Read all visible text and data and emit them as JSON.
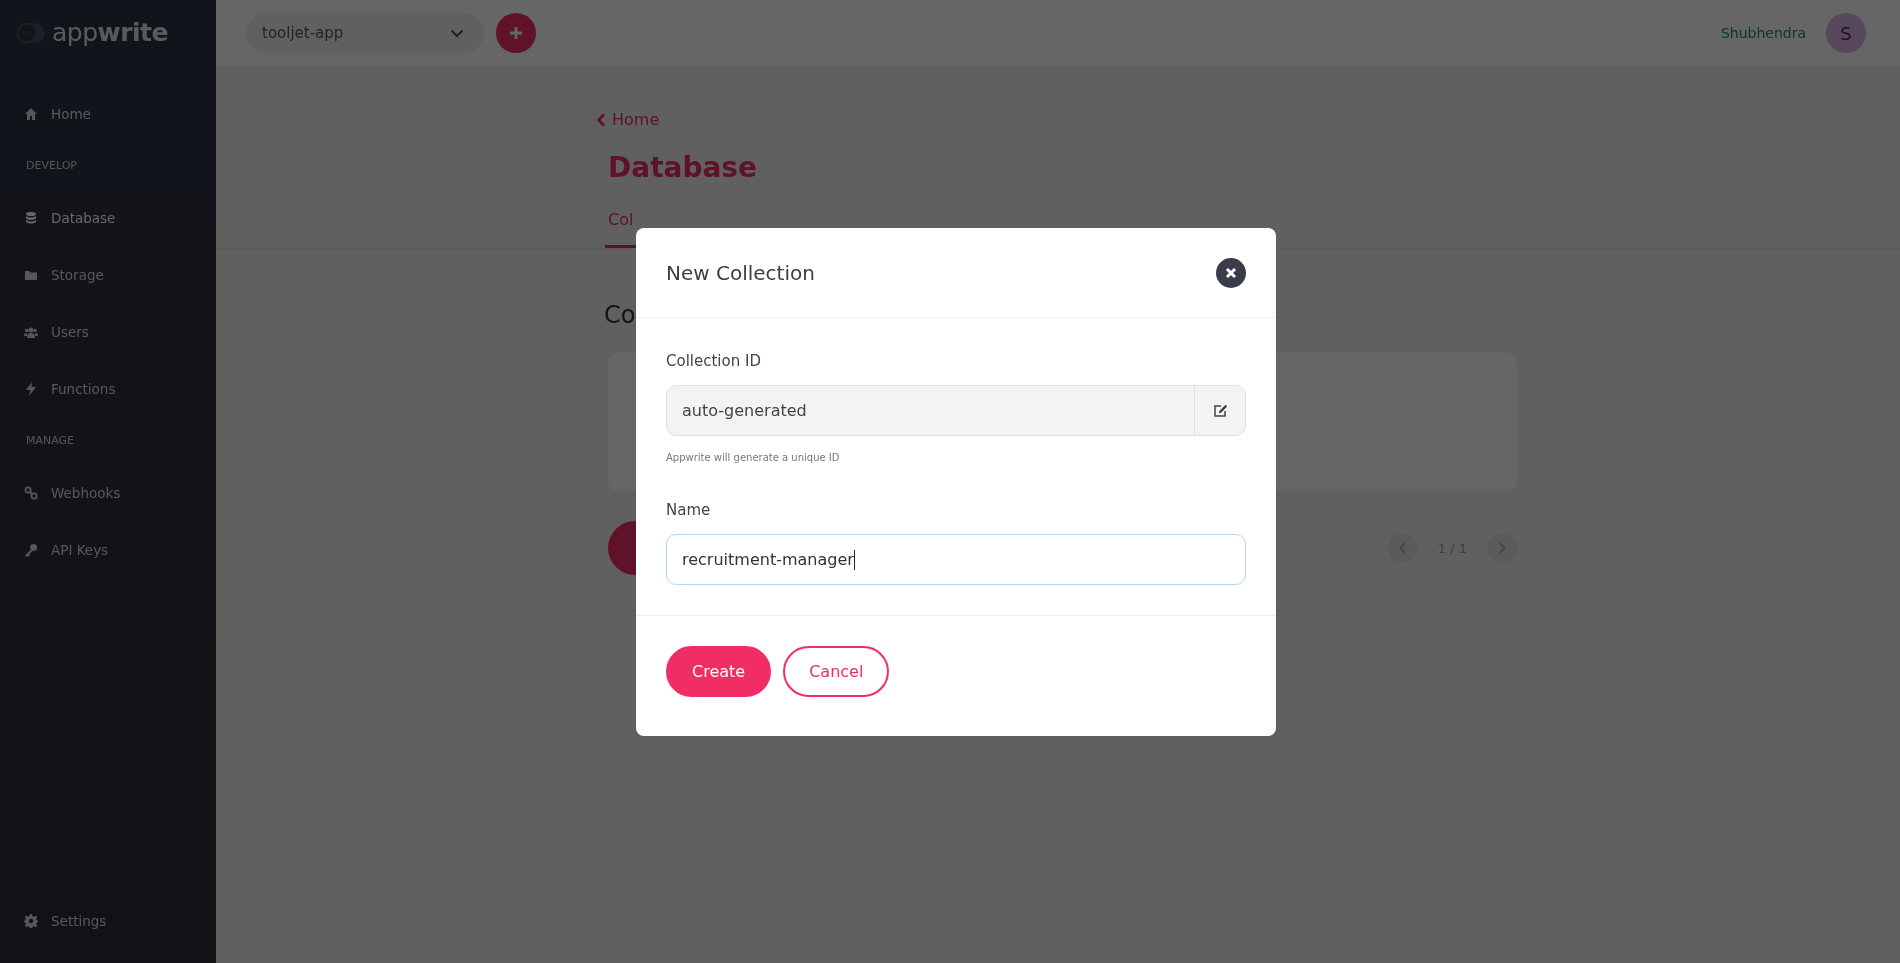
{
  "sidebar": {
    "logo": "app**write**",
    "sections": [
      {
        "items": [
          {
            "label": "Home",
            "selected": false
          }
        ]
      },
      {
        "heading": "DEVELOP",
        "items": [
          {
            "label": "Database",
            "selected": true
          },
          {
            "label": "Storage",
            "selected": false
          },
          {
            "label": "Users",
            "selected": false
          },
          {
            "label": "Functions",
            "selected": false
          }
        ]
      },
      {
        "heading": "MANAGE",
        "items": [
          {
            "label": "Webhooks",
            "selected": false
          },
          {
            "label": "API Keys",
            "selected": false
          }
        ]
      }
    ],
    "footer_item": {
      "label": "Settings",
      "selected": false
    }
  },
  "topbar": {
    "project": "tooljet-app",
    "user": "Shubhendra",
    "avatar": "S"
  },
  "page": {
    "back_link": "Home",
    "title": "Database",
    "tabs": [
      {
        "label": "Col",
        "selected": true
      }
    ],
    "section_heading": "Co",
    "pagination": "1 / 1"
  },
  "modal": {
    "title": "New Collection",
    "fields": [
      {
        "kind": "locked",
        "label": "Collection ID",
        "value": "auto-generated",
        "hint": "Appwrite will generate a unique ID",
        "focused": false
      },
      {
        "kind": "text",
        "label": "Name",
        "value": "recruitment-manager",
        "focused": true
      }
    ],
    "buttons": [
      {
        "kind": "primary",
        "label": "Create"
      },
      {
        "kind": "secondary",
        "label": "Cancel"
      }
    ]
  }
}
